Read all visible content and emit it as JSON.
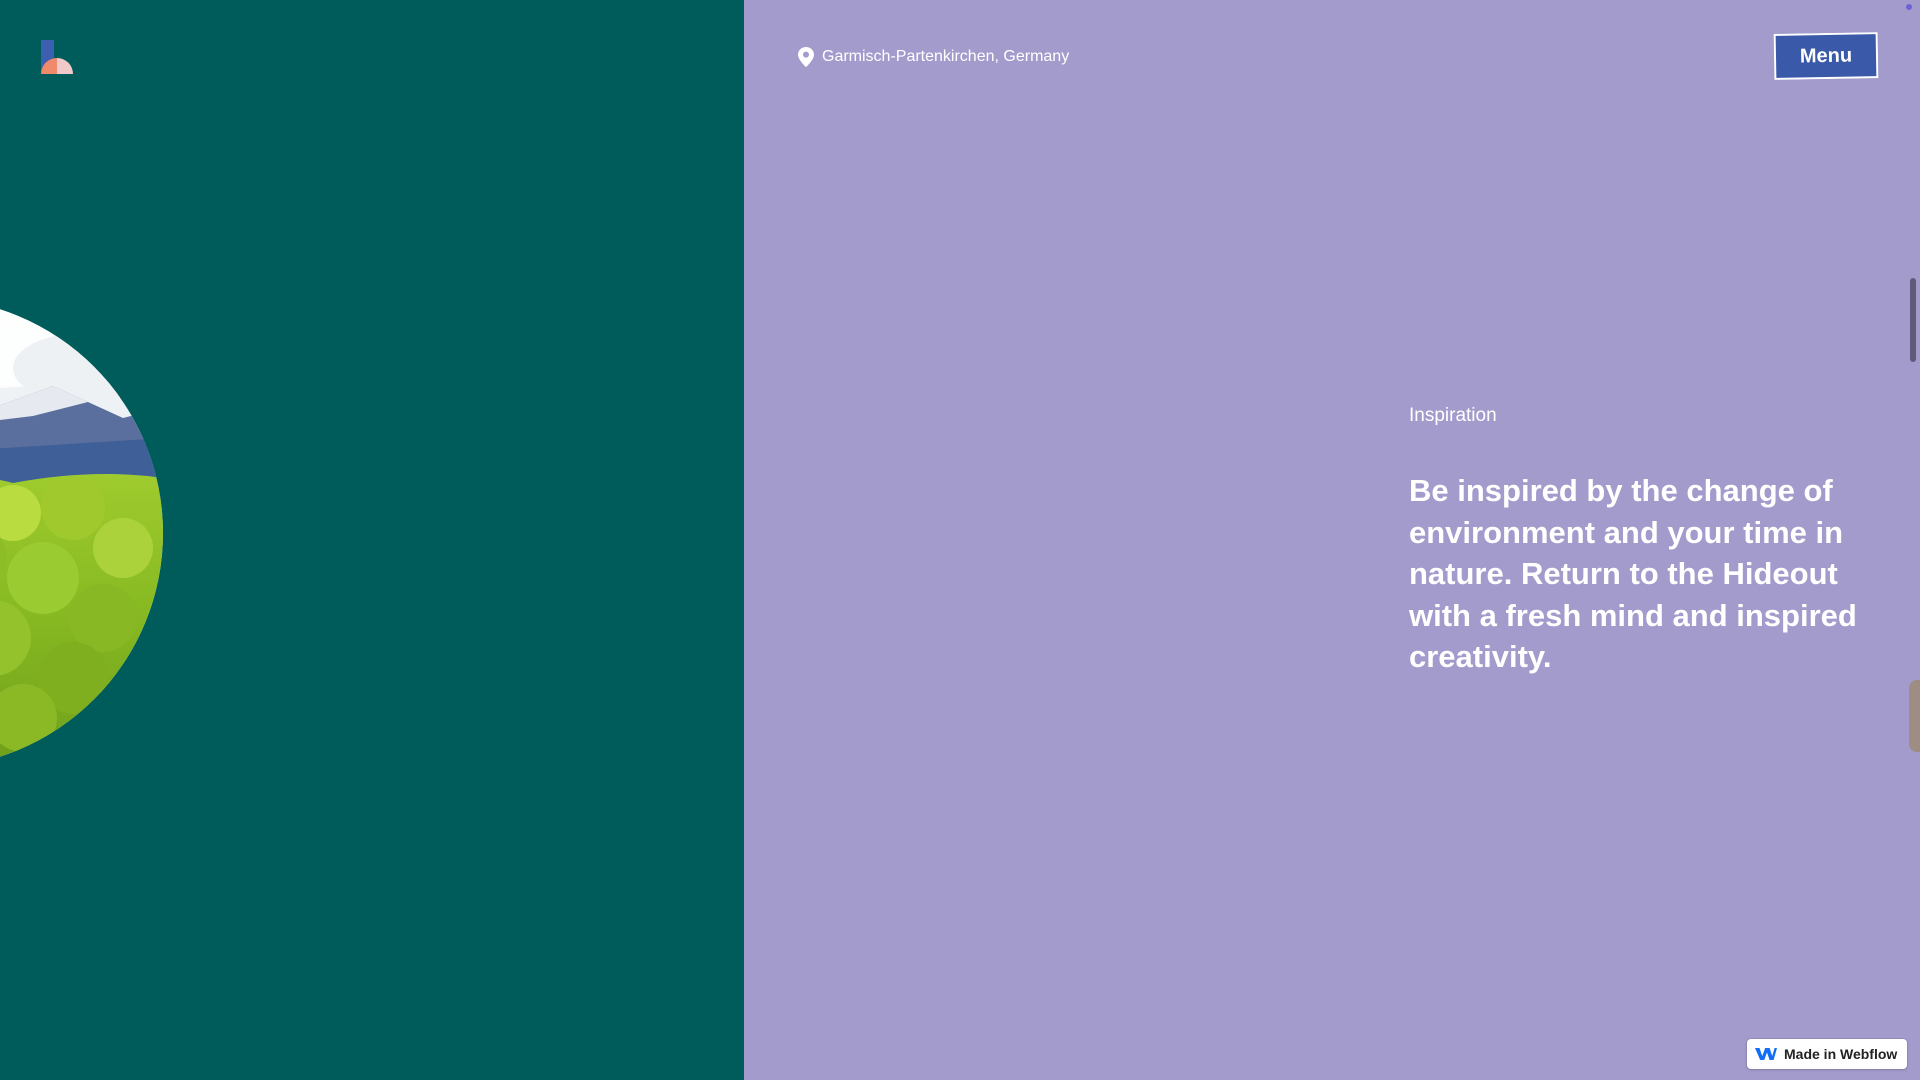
{
  "colors": {
    "left_bg": "#005c5b",
    "right_bg": "#a39bcb",
    "menu_bg": "#3a5aa9",
    "logo_blue": "#3c5fb0",
    "logo_coral": "#f08a6a",
    "logo_pink": "#f1c9c9",
    "scrollbar": "#5e5a7a",
    "webflow_blue": "#146ef5",
    "corner_dot": "#6c63d6"
  },
  "logo": {
    "icon": "hideout-logo-icon"
  },
  "location": {
    "icon": "map-pin-icon",
    "text": "Garmisch-Partenkirchen, Germany"
  },
  "menu": {
    "label": "Menu"
  },
  "section": {
    "label": "Inspiration",
    "headline": "Be inspired by the change of environment and your time in nature. Return to the Hideout with a fresh mind and inspired creativity."
  },
  "badge": {
    "icon": "webflow-logo-icon",
    "label": "Made in Webflow"
  }
}
